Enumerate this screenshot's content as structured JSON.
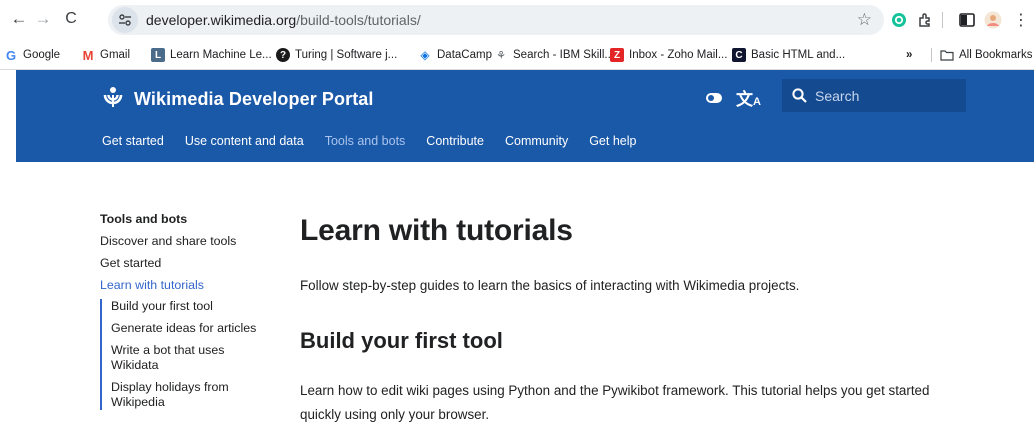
{
  "browser": {
    "url_host": "developer.wikimedia.org",
    "url_path": "/build-tools/tutorials/",
    "bookmarks": [
      {
        "label": "Google",
        "icon": "google-icon",
        "color": "#4285f4"
      },
      {
        "label": "Gmail",
        "icon": "gmail-icon",
        "color": "#ea4335"
      },
      {
        "label": "Learn Machine Le...",
        "icon": "ml-icon",
        "color": "#4b6b8a"
      },
      {
        "label": "Turing | Software j...",
        "icon": "turing-icon",
        "color": "#1a1a1a"
      },
      {
        "label": "DataCamp",
        "icon": "datacamp-icon",
        "color": "#03ef62"
      },
      {
        "label": "Search - IBM Skill...",
        "icon": "ibm-icon",
        "color": "#5f6368"
      },
      {
        "label": "Inbox - Zoho Mail...",
        "icon": "zoho-icon",
        "color": "#e42527"
      },
      {
        "label": "Basic HTML and...",
        "icon": "codecademy-icon",
        "color": "#10162f"
      }
    ],
    "more_bookmarks": "»",
    "all_bookmarks": "All Bookmarks"
  },
  "header": {
    "title": "Wikimedia Developer Portal",
    "search_placeholder": "Search",
    "nav": [
      {
        "label": "Get started",
        "current": false
      },
      {
        "label": "Use content and data",
        "current": false
      },
      {
        "label": "Tools and bots",
        "current": true
      },
      {
        "label": "Contribute",
        "current": false
      },
      {
        "label": "Community",
        "current": false
      },
      {
        "label": "Get help",
        "current": false
      }
    ]
  },
  "sidebar": {
    "title": "Tools and bots",
    "links": [
      "Discover and share tools",
      "Get started",
      "Learn with tutorials"
    ],
    "sub_links": [
      "Build your first tool",
      "Generate ideas for articles",
      "Write a bot that uses Wikidata",
      "Display holidays from Wikipedia"
    ]
  },
  "main": {
    "title": "Learn with tutorials",
    "lead": "Follow step-by-step guides to learn the basics of interacting with Wikimedia projects.",
    "section_title": "Build your first tool",
    "section_text": "Learn how to edit wiki pages using Python and the Pywikibot framework. This tutorial helps you get started quickly using only your browser."
  },
  "colors": {
    "header_bg": "#1a58a8",
    "link": "#3366cc"
  }
}
